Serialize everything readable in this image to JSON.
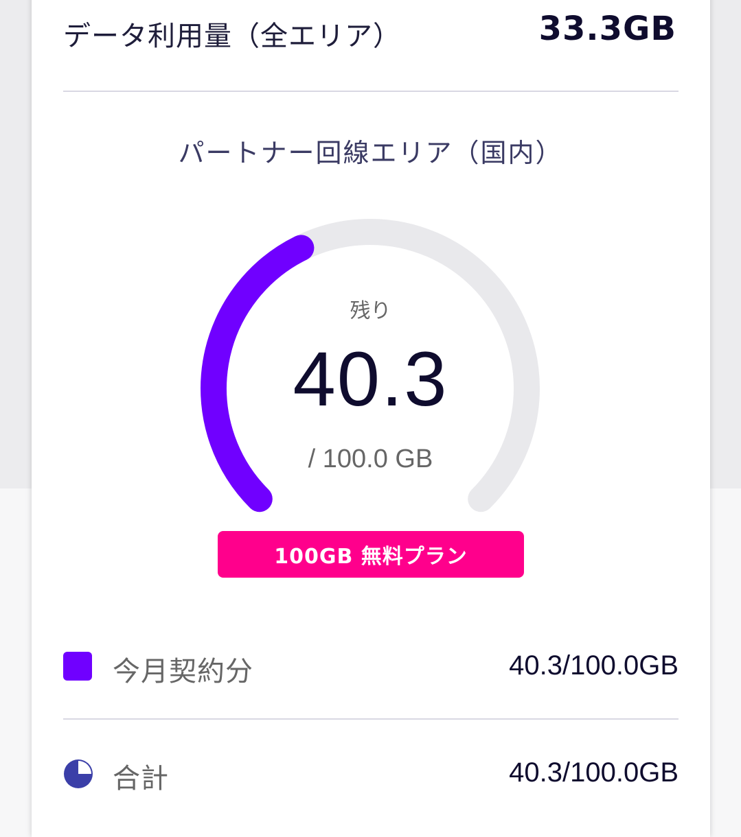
{
  "colors": {
    "accent": "#7000ff",
    "badge": "#ff008c",
    "track": "#e9e9ec",
    "pie": "#3b3fa8",
    "text_dark": "#0f0c2e"
  },
  "summary": {
    "label": "データ利用量（全エリア）",
    "value": "33.3GB"
  },
  "gauge": {
    "title": "パートナー回線エリア（国内）",
    "remaining_label": "残り",
    "remaining_value": "40.3",
    "total_text": "/ 100.0 GB",
    "remaining_fraction": 0.403,
    "plan_badge": "100GB 無料プラン"
  },
  "legend": [
    {
      "icon": "square-swatch-icon",
      "label": "今月契約分",
      "value": "40.3/100.0GB"
    },
    {
      "icon": "pie-clock-icon",
      "label": "合計",
      "value": "40.3/100.0GB"
    }
  ]
}
